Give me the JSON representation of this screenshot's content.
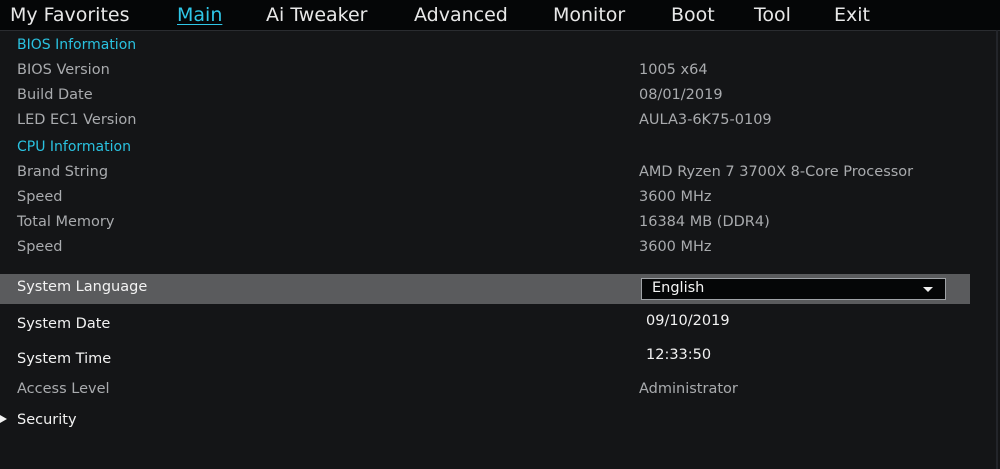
{
  "nav": {
    "tabs": [
      "My Favorites",
      "Main",
      "Ai Tweaker",
      "Advanced",
      "Monitor",
      "Boot",
      "Tool",
      "Exit"
    ],
    "active": "Main"
  },
  "bios": {
    "title": "BIOS Information",
    "version_label": "BIOS Version",
    "version_value": "1005  x64",
    "build_label": "Build Date",
    "build_value": "08/01/2019",
    "led_label": "LED EC1 Version",
    "led_value": "AULA3-6K75-0109"
  },
  "cpu": {
    "title": "CPU Information",
    "brand_label": "Brand String",
    "brand_value": "AMD Ryzen 7 3700X 8-Core Processor",
    "speed_label": "Speed",
    "speed_value": "3600 MHz",
    "memory_label": "Total Memory",
    "memory_value": "16384 MB (DDR4)",
    "speed2_label": "Speed",
    "speed2_value": "3600 MHz"
  },
  "system": {
    "language_label": "System Language",
    "language_value": "English",
    "date_label": "System Date",
    "date_value": "09/10/2019",
    "time_label": "System Time",
    "time_value": "12:33:50",
    "access_label": "Access Level",
    "access_value": "Administrator",
    "security_label": "Security"
  },
  "colors": {
    "accent": "#2ac2e0",
    "background": "#141517",
    "highlight": "#5a5b5d",
    "text_dim": "#a9abae",
    "text_bright": "#f2f2f2"
  }
}
